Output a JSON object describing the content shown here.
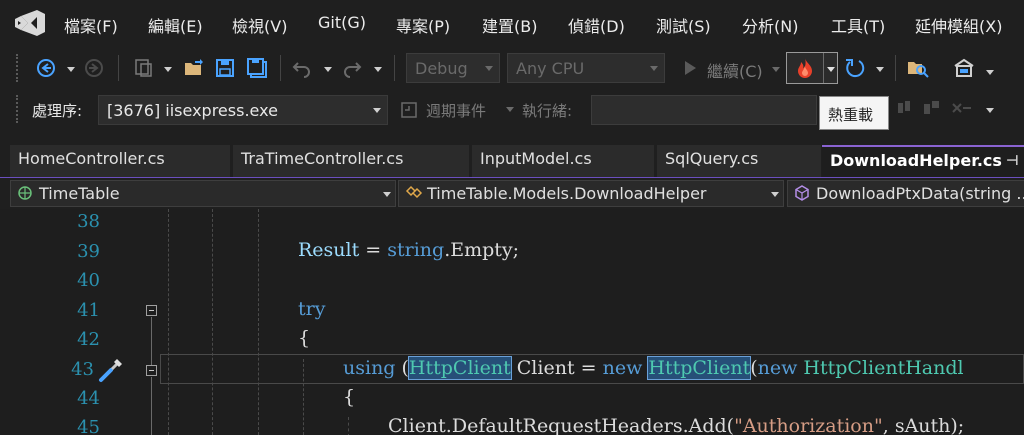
{
  "menu": {
    "items": [
      "檔案(F)",
      "編輯(E)",
      "檢視(V)",
      "Git(G)",
      "專案(P)",
      "建置(B)",
      "偵錯(D)",
      "測試(S)",
      "分析(N)",
      "工具(T)",
      "延伸模組(X)"
    ]
  },
  "toolbar": {
    "config_value": "Debug",
    "platform_value": "Any CPU",
    "continue_label": "繼續(C)",
    "hot_reload_tooltip": "熱重載"
  },
  "debug_location": {
    "process_label": "處理序:",
    "process_value": "[3676] iisexpress.exe",
    "lifecycle_label": "週期事件",
    "thread_label": "執行緒:"
  },
  "tabs": [
    {
      "label": "HomeController.cs",
      "active": false
    },
    {
      "label": "TraTimeController.cs",
      "active": false
    },
    {
      "label": "InputModel.cs",
      "active": false
    },
    {
      "label": "SqlQuery.cs",
      "active": false
    },
    {
      "label": "DownloadHelper.cs",
      "active": true
    }
  ],
  "navbar": {
    "project": "TimeTable",
    "type": "TimeTable.Models.DownloadHelper",
    "member": "DownloadPtxData(string ..."
  },
  "editor": {
    "line_numbers": [
      "38",
      "39",
      "40",
      "41",
      "42",
      "43",
      "44",
      "45"
    ],
    "lines": [
      {
        "indent": "",
        "tokens": []
      },
      {
        "indent": "",
        "tokens": [
          {
            "t": "Result",
            "c": "id"
          },
          {
            "t": " = ",
            "c": ""
          },
          {
            "t": "string",
            "c": "kw"
          },
          {
            "t": ".Empty;",
            "c": ""
          }
        ]
      },
      {
        "indent": "",
        "tokens": []
      },
      {
        "indent": "",
        "tokens": [
          {
            "t": "try",
            "c": "kw"
          }
        ]
      },
      {
        "indent": "",
        "tokens": [
          {
            "t": "{",
            "c": ""
          }
        ]
      },
      {
        "indent": "    ",
        "tokens": [
          {
            "t": "using",
            "c": "kw"
          },
          {
            "t": " (",
            "c": ""
          },
          {
            "t": "HttpClient",
            "c": "ty hl"
          },
          {
            "t": " Client = ",
            "c": ""
          },
          {
            "t": "new",
            "c": "kw"
          },
          {
            "t": " ",
            "c": ""
          },
          {
            "t": "HttpClient",
            "c": "ty hl"
          },
          {
            "t": "(",
            "c": ""
          },
          {
            "t": "new",
            "c": "kw"
          },
          {
            "t": " ",
            "c": ""
          },
          {
            "t": "HttpClientHandl",
            "c": "ty"
          }
        ]
      },
      {
        "indent": "    ",
        "tokens": [
          {
            "t": "{",
            "c": ""
          }
        ]
      },
      {
        "indent": "        ",
        "tokens": [
          {
            "t": "Client.DefaultRequestHeaders.Add(",
            "c": ""
          },
          {
            "t": "\"Authorization\"",
            "c": "st"
          },
          {
            "t": ", sAuth);",
            "c": ""
          }
        ]
      }
    ]
  },
  "colors": {
    "accent": "#8a63d2",
    "keyword": "#569cd6",
    "type": "#4ec9b0",
    "string": "#d69d85",
    "line_number": "#2b91af",
    "hot_reload": "#e8402a"
  }
}
